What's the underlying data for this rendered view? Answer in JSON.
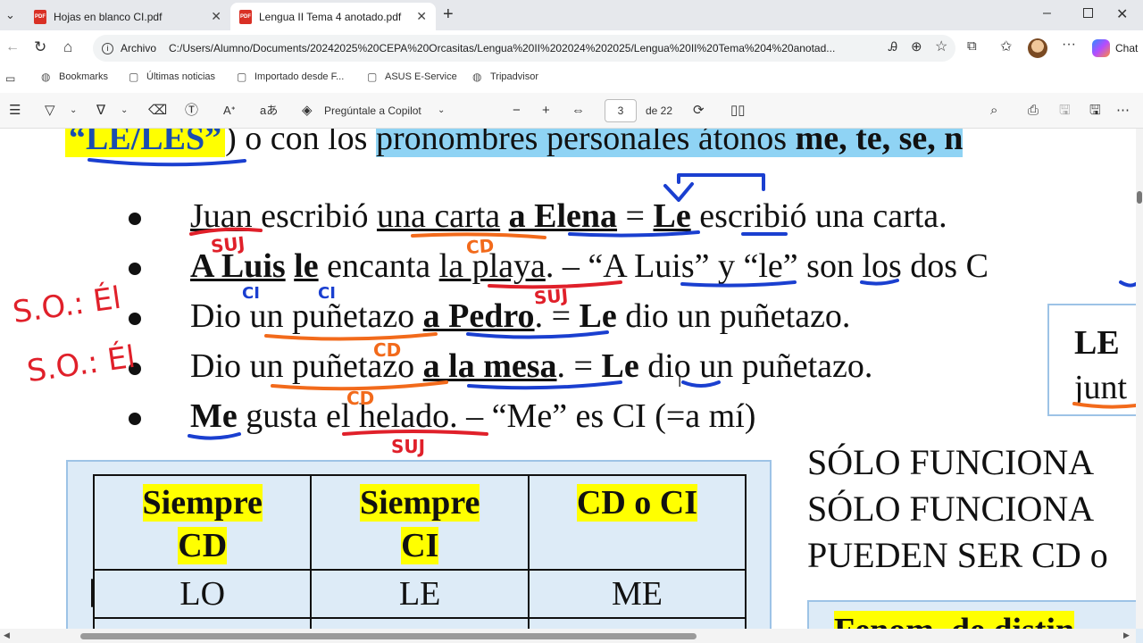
{
  "tabs": [
    {
      "title": "Hojas en blanco CI.pdf",
      "active": false
    },
    {
      "title": "Lengua II Tema 4 anotado.pdf",
      "active": true
    }
  ],
  "address": {
    "label": "Archivo",
    "url": "C:/Users/Alumno/Documents/20242025%20CEPA%20Orcasitas/Lengua%20II%202024%202025/Lengua%20II%20Tema%204%20anotad..."
  },
  "bookmarks": [
    "Bookmarks",
    "Últimas noticias",
    "Importado desde F...",
    "ASUS E-Service",
    "Tripadvisor"
  ],
  "pdf_toolbar": {
    "copilot_label": "Pregúntale a Copilot",
    "page_current": "3",
    "page_total": "de 22"
  },
  "chat_label": "Chat",
  "document": {
    "top_line": {
      "part1": "“LE/LES”",
      "part2": ") o con los ",
      "part3": "pronombres personales átonos ",
      "part4": "me, te, se, n"
    },
    "bullets": [
      {
        "pre": "",
        "u1": "Juan",
        "mid1": " escribió ",
        "u2": "una carta",
        "mid2": " ",
        "b": "a Elena",
        "mid3": " = ",
        "b2": "Le",
        "post": " escribió una carta."
      },
      {
        "b": "A Luis",
        "sp": " ",
        "b2": "le",
        "mid": " encanta ",
        "u": "la playa",
        "post": ". – “A Luis” y “le” son los dos C"
      },
      {
        "pre": "Dio ",
        "u": "un puñetazo",
        "mid": " ",
        "b": "a Pedro",
        "mid2": ". = ",
        "b2": "Le",
        "post": " dio un puñetazo."
      },
      {
        "pre": "Dio ",
        "u": "un puñetazo",
        "mid": " ",
        "b": "a la mesa",
        "mid2": ". = ",
        "b2": "Le",
        "post": " dio un puñetazo."
      },
      {
        "b": "Me",
        "mid": " gusta ",
        "u": "el helado",
        "post": ". – “Me” es CI (=a mí)"
      }
    ],
    "side_box": {
      "l1": "LE",
      "l2": "junt"
    },
    "right_text": [
      "SÓLO FUNCIONA",
      "SÓLO FUNCIONA",
      "PUEDEN SER CD o"
    ],
    "table": {
      "headers": [
        [
          "Siempre",
          "CD"
        ],
        [
          "Siempre",
          "CI"
        ],
        [
          "CD o CI"
        ]
      ],
      "row1": [
        "LO",
        "LE",
        "ME"
      ]
    },
    "bottom_box": "Fenom. de distin",
    "annotations": [
      "SUJ",
      "CD",
      "SUJ",
      "CI",
      "CI",
      "S.O.: Él",
      "S.O.: Él",
      "CD",
      "CD",
      "SUJ"
    ]
  },
  "colors": {
    "highlight_yellow": "#ffff00",
    "highlight_blue": "#8fd3f4",
    "ink_red": "#e0202a",
    "ink_blue": "#1a3fd0",
    "ink_orange": "#f26a1b"
  }
}
